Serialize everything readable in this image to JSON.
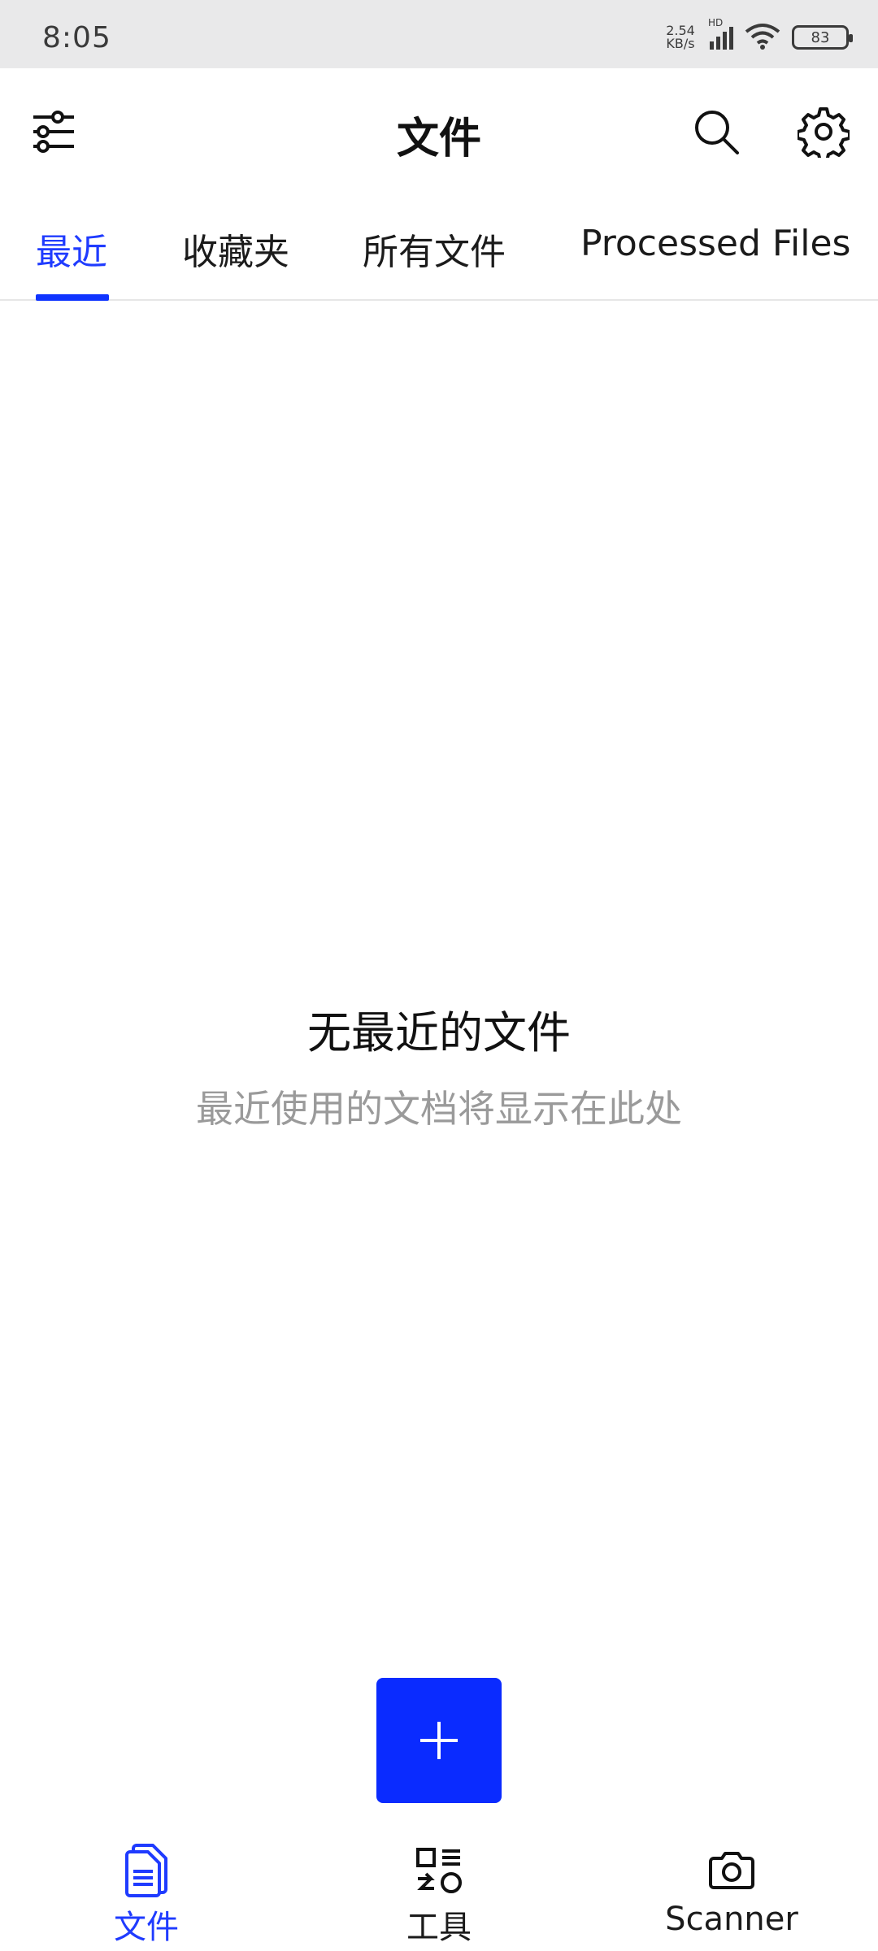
{
  "status_bar": {
    "time": "8:05",
    "net_speed_value": "2.54",
    "net_speed_unit": "KB/s",
    "network_badge": "HD",
    "battery": "83"
  },
  "app_bar": {
    "title": "文件",
    "icons": [
      "filter-icon",
      "search-icon",
      "gear-icon"
    ]
  },
  "tabs": [
    {
      "label": "最近",
      "active": true
    },
    {
      "label": "收藏夹",
      "active": false
    },
    {
      "label": "所有文件",
      "active": false
    },
    {
      "label": "Processed Files",
      "active": false
    }
  ],
  "empty_state": {
    "title": "无最近的文件",
    "subtitle": "最近使用的文档将显示在此处"
  },
  "fab": {
    "icon": "plus-icon"
  },
  "bottom_nav": [
    {
      "label": "文件",
      "icon": "document-icon",
      "active": true
    },
    {
      "label": "工具",
      "icon": "tools-icon",
      "active": false
    },
    {
      "label": "Scanner",
      "icon": "camera-icon",
      "active": false
    }
  ],
  "colors": {
    "accent": "#0a2bff",
    "text_primary": "#111111",
    "text_secondary": "#9a9a9a",
    "status_bar_bg": "#e9e9ea"
  }
}
